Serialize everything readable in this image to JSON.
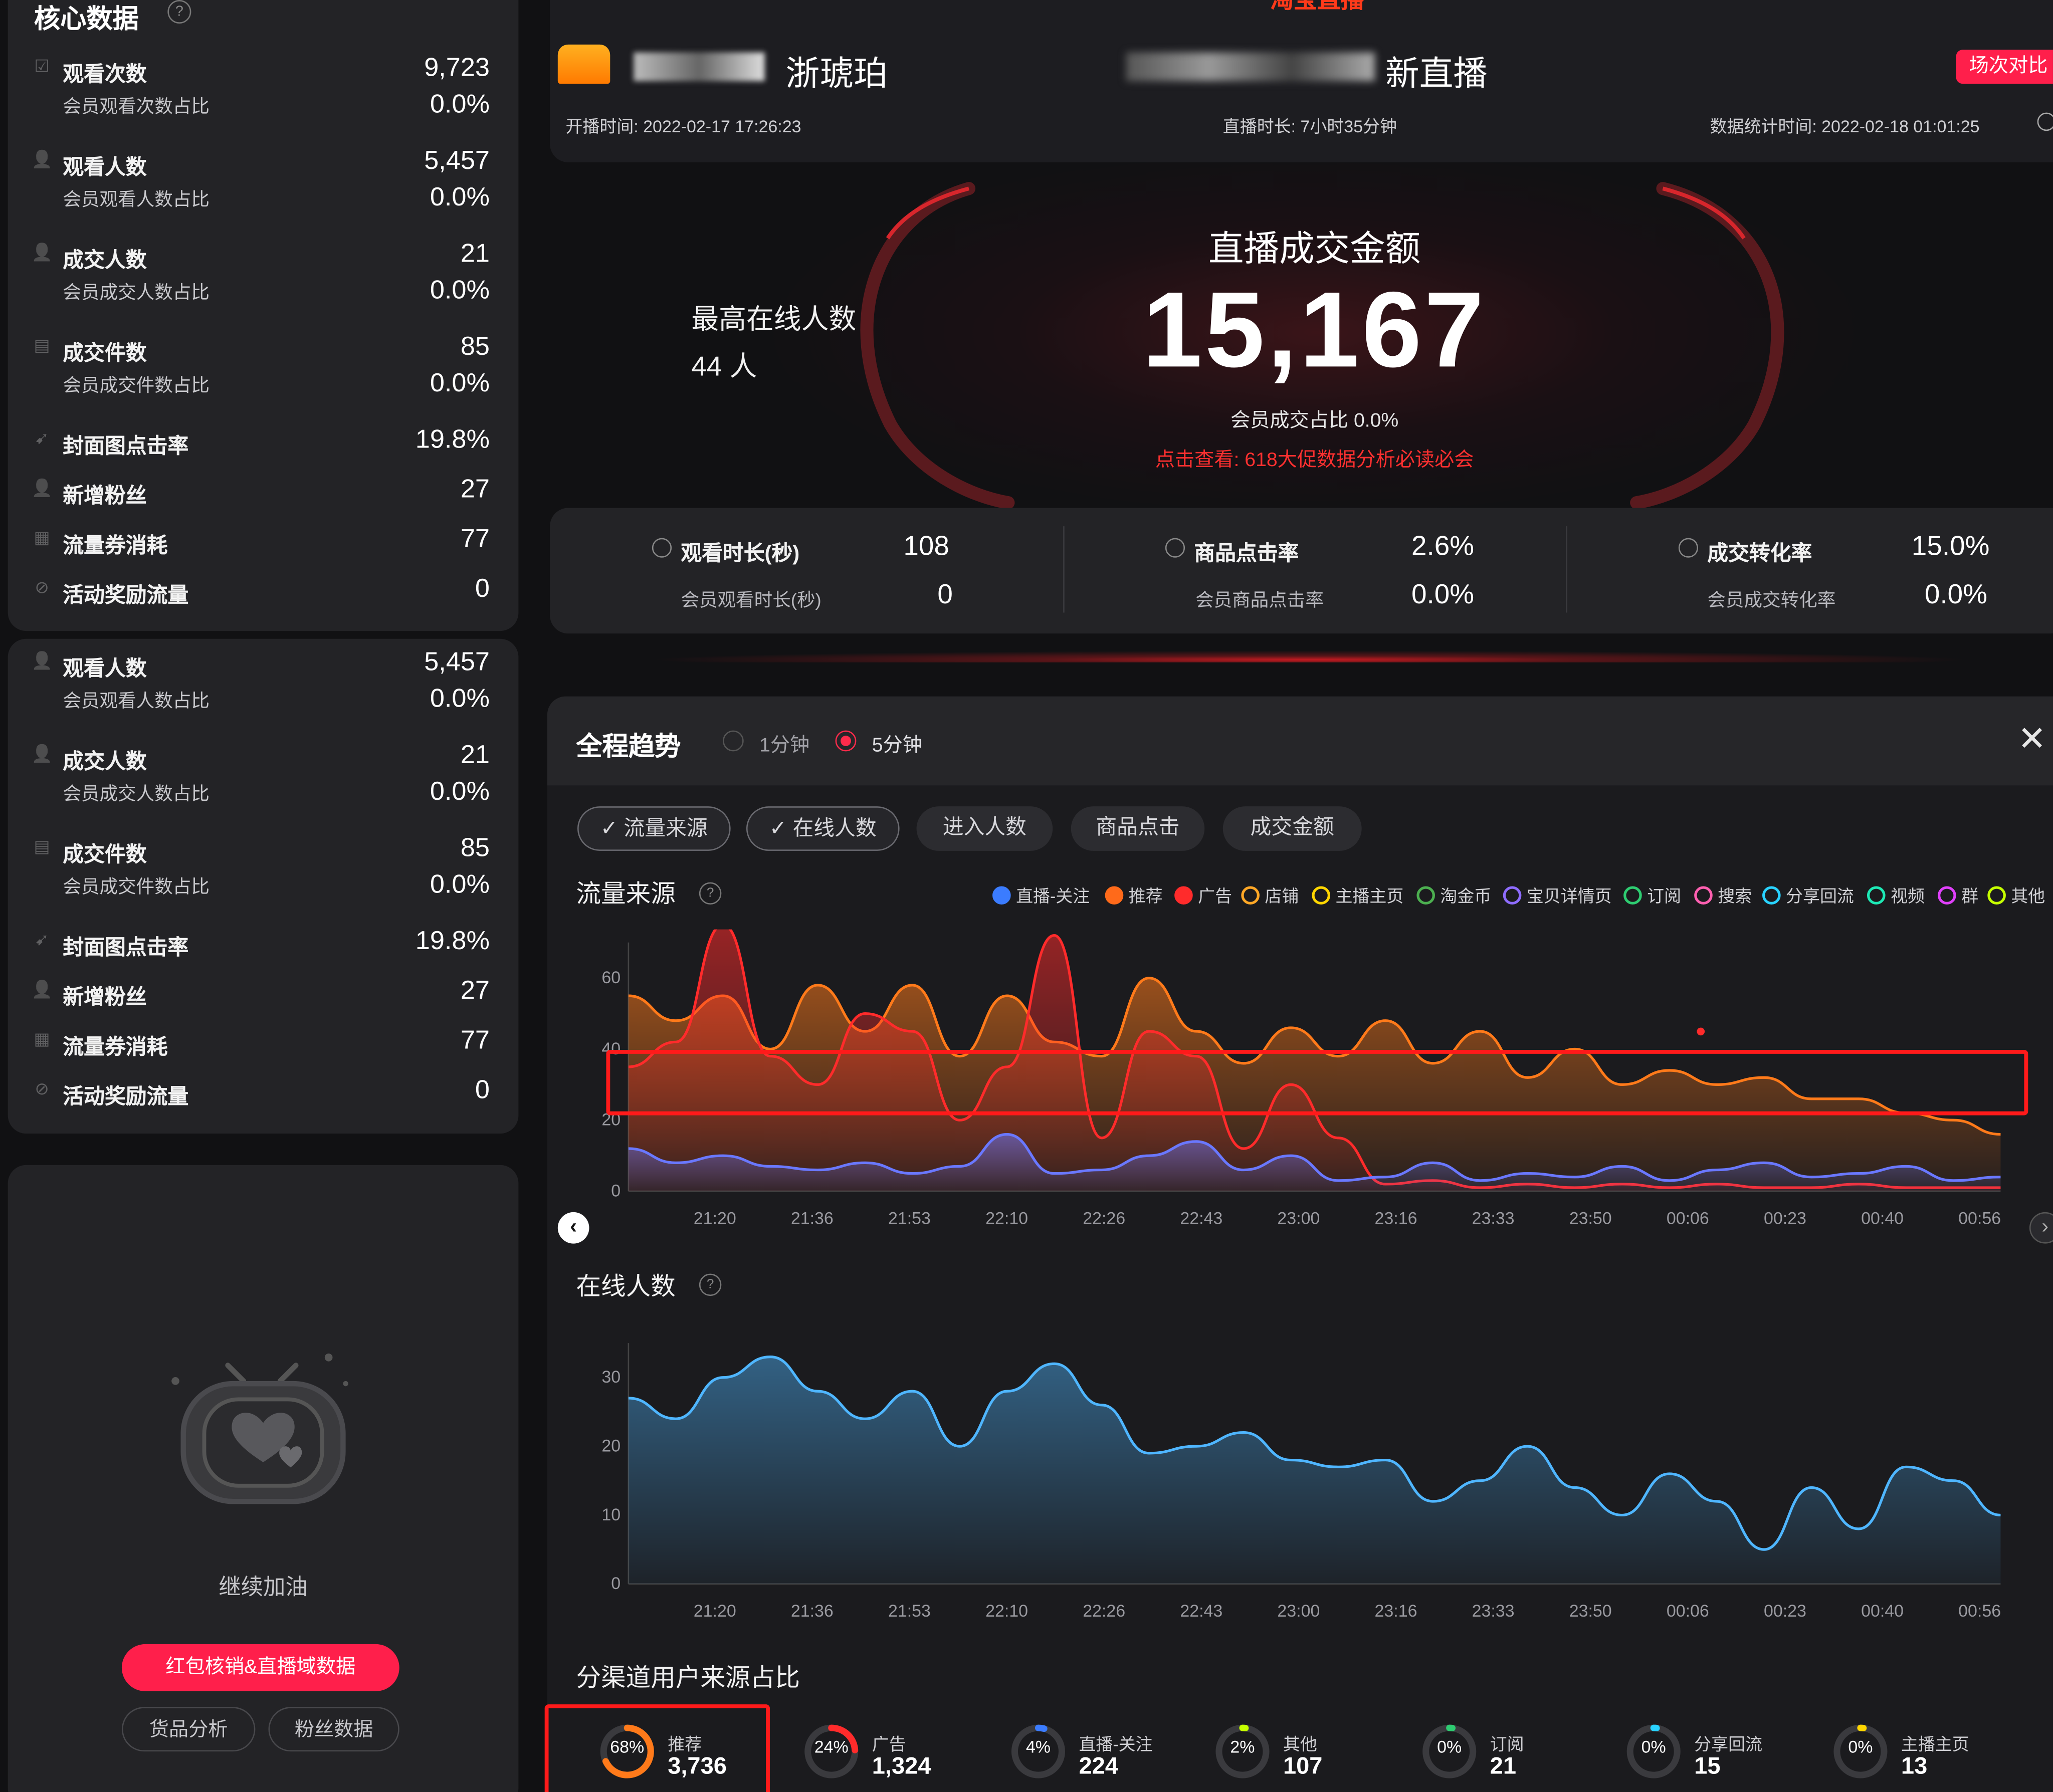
{
  "sidebar": {
    "title": "核心数据",
    "group1": [
      {
        "icon": "checkbox-icon",
        "label": "观看次数",
        "value": "9,723",
        "sub_label": "会员观看次数占比",
        "sub_value": "0.0%"
      },
      {
        "icon": "user-icon",
        "label": "观看人数",
        "value": "5,457",
        "sub_label": "会员观看人数占比",
        "sub_value": "0.0%"
      },
      {
        "icon": "user-icon",
        "label": "成交人数",
        "value": "21",
        "sub_label": "会员成交人数占比",
        "sub_value": "0.0%"
      },
      {
        "icon": "box-icon",
        "label": "成交件数",
        "value": "85",
        "sub_label": "会员成交件数占比",
        "sub_value": "0.0%"
      },
      {
        "icon": "cursor-icon",
        "label": "封面图点击率",
        "value": "19.8%"
      },
      {
        "icon": "user-add-icon",
        "label": "新增粉丝",
        "value": "27"
      },
      {
        "icon": "ticket-icon",
        "label": "流量券消耗",
        "value": "77"
      },
      {
        "icon": "reward-icon",
        "label": "活动奖励流量",
        "value": "0"
      }
    ],
    "group2": [
      {
        "icon": "user-icon",
        "label": "观看人数",
        "value": "5,457",
        "sub_label": "会员观看人数占比",
        "sub_value": "0.0%"
      },
      {
        "icon": "user-icon",
        "label": "成交人数",
        "value": "21",
        "sub_label": "会员成交人数占比",
        "sub_value": "0.0%"
      },
      {
        "icon": "box-icon",
        "label": "成交件数",
        "value": "85",
        "sub_label": "会员成交件数占比",
        "sub_value": "0.0%"
      },
      {
        "icon": "cursor-icon",
        "label": "封面图点击率",
        "value": "19.8%"
      },
      {
        "icon": "user-add-icon",
        "label": "新增粉丝",
        "value": "27"
      },
      {
        "icon": "ticket-icon",
        "label": "流量券消耗",
        "value": "77"
      },
      {
        "icon": "reward-icon",
        "label": "活动奖励流量",
        "value": "0"
      }
    ],
    "encourage_text": "继续加油",
    "primary_button": "红包核销&直播域数据",
    "buttons": [
      "货品分析",
      "粉丝数据"
    ]
  },
  "header": {
    "top_logo": "淘宝直播",
    "anchor_name_suffix": "浙琥珀",
    "title_suffix": "新直播",
    "compare_button": "场次对比",
    "start_time": "开播时间: 2022-02-17 17:26:23",
    "duration": "直播时长: 7小时35分钟",
    "stat_time": "数据统计时间: 2022-02-18 01:01:25"
  },
  "hero": {
    "peak_label": "最高在线人数",
    "peak_value": "44 人",
    "gmv_label": "直播成交金额",
    "gmv_value": "15,167",
    "member_ratio": "会员成交占比 0.0%",
    "promo_link": "点击查看: 618大促数据分析必读必会"
  },
  "kpis": [
    {
      "label": "观看时长(秒)",
      "value": "108",
      "sub_label": "会员观看时长(秒)",
      "sub_value": "0"
    },
    {
      "label": "商品点击率",
      "value": "2.6%",
      "sub_label": "会员商品点击率",
      "sub_value": "0.0%"
    },
    {
      "label": "成交转化率",
      "value": "15.0%",
      "sub_label": "会员成交转化率",
      "sub_value": "0.0%"
    }
  ],
  "trend": {
    "title": "全程趋势",
    "radio_1": "1分钟",
    "radio_5": "5分钟",
    "chips": [
      {
        "label": "流量来源",
        "checked": true
      },
      {
        "label": "在线人数",
        "checked": true
      },
      {
        "label": "进入人数",
        "checked": false
      },
      {
        "label": "商品点击",
        "checked": false
      },
      {
        "label": "成交金额",
        "checked": false
      }
    ],
    "traffic_title": "流量来源",
    "online_title": "在线人数",
    "legend": [
      {
        "name": "直播-关注",
        "color": "#3b7cff",
        "checked": true
      },
      {
        "name": "推荐",
        "color": "#ff6a1a",
        "checked": true
      },
      {
        "name": "广告",
        "color": "#ff2b2b",
        "checked": true
      },
      {
        "name": "店铺",
        "color": "#ffa726",
        "checked": false
      },
      {
        "name": "主播主页",
        "color": "#ffd600",
        "checked": false
      },
      {
        "name": "淘金币",
        "color": "#4caf50",
        "checked": false
      },
      {
        "name": "宝贝详情页",
        "color": "#8e6cff",
        "checked": false
      },
      {
        "name": "订阅",
        "color": "#2ecc71",
        "checked": false
      },
      {
        "name": "搜索",
        "color": "#ff5fb0",
        "checked": false
      },
      {
        "name": "分享回流",
        "color": "#29d2ff",
        "checked": false
      },
      {
        "name": "视频",
        "color": "#1de9b6",
        "checked": false
      },
      {
        "name": "群",
        "color": "#e040fb",
        "checked": false
      },
      {
        "name": "其他",
        "color": "#c6ff00",
        "checked": false
      }
    ],
    "channel_title": "分渠道用户来源占比"
  },
  "chart_data": [
    {
      "type": "area",
      "title": "流量来源",
      "x": [
        "21:20",
        "21:36",
        "21:53",
        "22:10",
        "22:26",
        "22:43",
        "23:00",
        "23:16",
        "23:33",
        "23:50",
        "00:06",
        "00:23",
        "00:40",
        "00:56"
      ],
      "ylim": [
        0,
        70
      ],
      "yticks": [
        0,
        20,
        40,
        60
      ],
      "series": [
        {
          "name": "推荐",
          "color": "#ff7a1a",
          "values": [
            55,
            48,
            55,
            40,
            58,
            45,
            58,
            38,
            55,
            42,
            38,
            60,
            45,
            36,
            46,
            38,
            48,
            36,
            45,
            32,
            40,
            30,
            34,
            30,
            32,
            26,
            26,
            22,
            20,
            16
          ]
        },
        {
          "name": "广告",
          "color": "#ff2b2b",
          "values": [
            35,
            42,
            75,
            38,
            30,
            50,
            45,
            20,
            35,
            72,
            15,
            45,
            38,
            12,
            30,
            15,
            2,
            3,
            1,
            2,
            1,
            2,
            1,
            2,
            1,
            1,
            2,
            1,
            1,
            1
          ]
        },
        {
          "name": "直播-关注",
          "color": "#6a78ff",
          "values": [
            12,
            8,
            10,
            7,
            6,
            8,
            5,
            7,
            16,
            5,
            6,
            10,
            14,
            6,
            10,
            3,
            4,
            8,
            3,
            5,
            4,
            7,
            3,
            6,
            8,
            4,
            5,
            7,
            3,
            4
          ]
        }
      ]
    },
    {
      "type": "area",
      "title": "在线人数",
      "x": [
        "21:20",
        "21:36",
        "21:53",
        "22:10",
        "22:26",
        "22:43",
        "23:00",
        "23:16",
        "23:33",
        "23:50",
        "00:06",
        "00:23",
        "00:40",
        "00:56"
      ],
      "ylim": [
        0,
        35
      ],
      "yticks": [
        0,
        10,
        20,
        30
      ],
      "series": [
        {
          "name": "在线人数",
          "color": "#4fb6ff",
          "values": [
            27,
            24,
            30,
            33,
            28,
            24,
            28,
            20,
            28,
            32,
            26,
            19,
            20,
            22,
            18,
            17,
            18,
            12,
            15,
            20,
            14,
            10,
            16,
            12,
            5,
            14,
            8,
            17,
            15,
            10
          ]
        }
      ]
    },
    {
      "type": "pie",
      "title": "分渠道用户来源占比",
      "series": [
        {
          "name": "推荐",
          "pct": 68,
          "value": "3,736",
          "color": "#ff7a1a"
        },
        {
          "name": "广告",
          "pct": 24,
          "value": "1,324",
          "color": "#ff2b2b"
        },
        {
          "name": "直播-关注",
          "pct": 4,
          "value": "224",
          "color": "#3b7cff"
        },
        {
          "name": "其他",
          "pct": 2,
          "value": "107",
          "color": "#c6ff00"
        },
        {
          "name": "订阅",
          "pct": 0,
          "value": "21",
          "color": "#2ecc71"
        },
        {
          "name": "分享回流",
          "pct": 0,
          "value": "15",
          "color": "#29d2ff"
        },
        {
          "name": "主播主页",
          "pct": 0,
          "value": "13",
          "color": "#ffd600"
        }
      ]
    }
  ]
}
